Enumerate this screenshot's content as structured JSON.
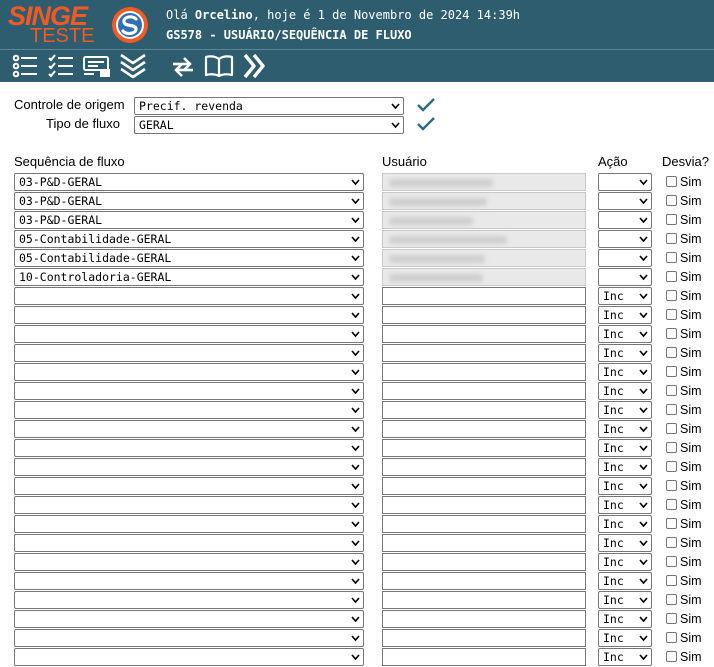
{
  "header": {
    "brand": "SINGE",
    "brand_sub": "TESTE",
    "greeting_prefix": "Olá ",
    "user_name": "Orcelino",
    "greeting_suffix": ", hoje é 1 de Novembro de 2024 14:39h",
    "program_title": "GS578 - USUÁRIO/SEQUÊNCIA DE FLUXO"
  },
  "toolbar": {
    "icons": [
      "list-icon",
      "checklist-icon",
      "form-icon",
      "chevrons-down-icon",
      "refresh-icon",
      "book-icon",
      "chevrons-right-icon"
    ]
  },
  "form": {
    "origem_label": "Controle de origem",
    "origem_value": "Precif. revenda",
    "tipo_label": "Tipo de fluxo",
    "tipo_value": "GERAL"
  },
  "table": {
    "headers": {
      "sequencia": "Sequência de fluxo",
      "usuario": "Usuário",
      "acao": "Ação",
      "desvia": "Desvia?"
    },
    "sim_label": "Sim",
    "rows": [
      {
        "sequencia": "03-P&D-GERAL",
        "acao": ""
      },
      {
        "sequencia": "03-P&D-GERAL",
        "acao": ""
      },
      {
        "sequencia": "03-P&D-GERAL",
        "acao": ""
      },
      {
        "sequencia": "05-Contabilidade-GERAL",
        "acao": ""
      },
      {
        "sequencia": "05-Contabilidade-GERAL",
        "acao": ""
      },
      {
        "sequencia": "10-Controladoria-GERAL",
        "acao": ""
      },
      {
        "sequencia": "",
        "acao": "Inc"
      },
      {
        "sequencia": "",
        "acao": "Inc"
      },
      {
        "sequencia": "",
        "acao": "Inc"
      },
      {
        "sequencia": "",
        "acao": "Inc"
      },
      {
        "sequencia": "",
        "acao": "Inc"
      },
      {
        "sequencia": "",
        "acao": "Inc"
      },
      {
        "sequencia": "",
        "acao": "Inc"
      },
      {
        "sequencia": "",
        "acao": "Inc"
      },
      {
        "sequencia": "",
        "acao": "Inc"
      },
      {
        "sequencia": "",
        "acao": "Inc"
      },
      {
        "sequencia": "",
        "acao": "Inc"
      },
      {
        "sequencia": "",
        "acao": "Inc"
      },
      {
        "sequencia": "",
        "acao": "Inc"
      },
      {
        "sequencia": "",
        "acao": "Inc"
      },
      {
        "sequencia": "",
        "acao": "Inc"
      },
      {
        "sequencia": "",
        "acao": "Inc"
      },
      {
        "sequencia": "",
        "acao": "Inc"
      },
      {
        "sequencia": "",
        "acao": "Inc"
      },
      {
        "sequencia": "",
        "acao": "Inc"
      },
      {
        "sequencia": "",
        "acao": "Inc"
      }
    ]
  },
  "colors": {
    "header_bg": "#2f5d70",
    "brand_orange": "#f15a22",
    "check_teal": "#2b6c7e"
  }
}
